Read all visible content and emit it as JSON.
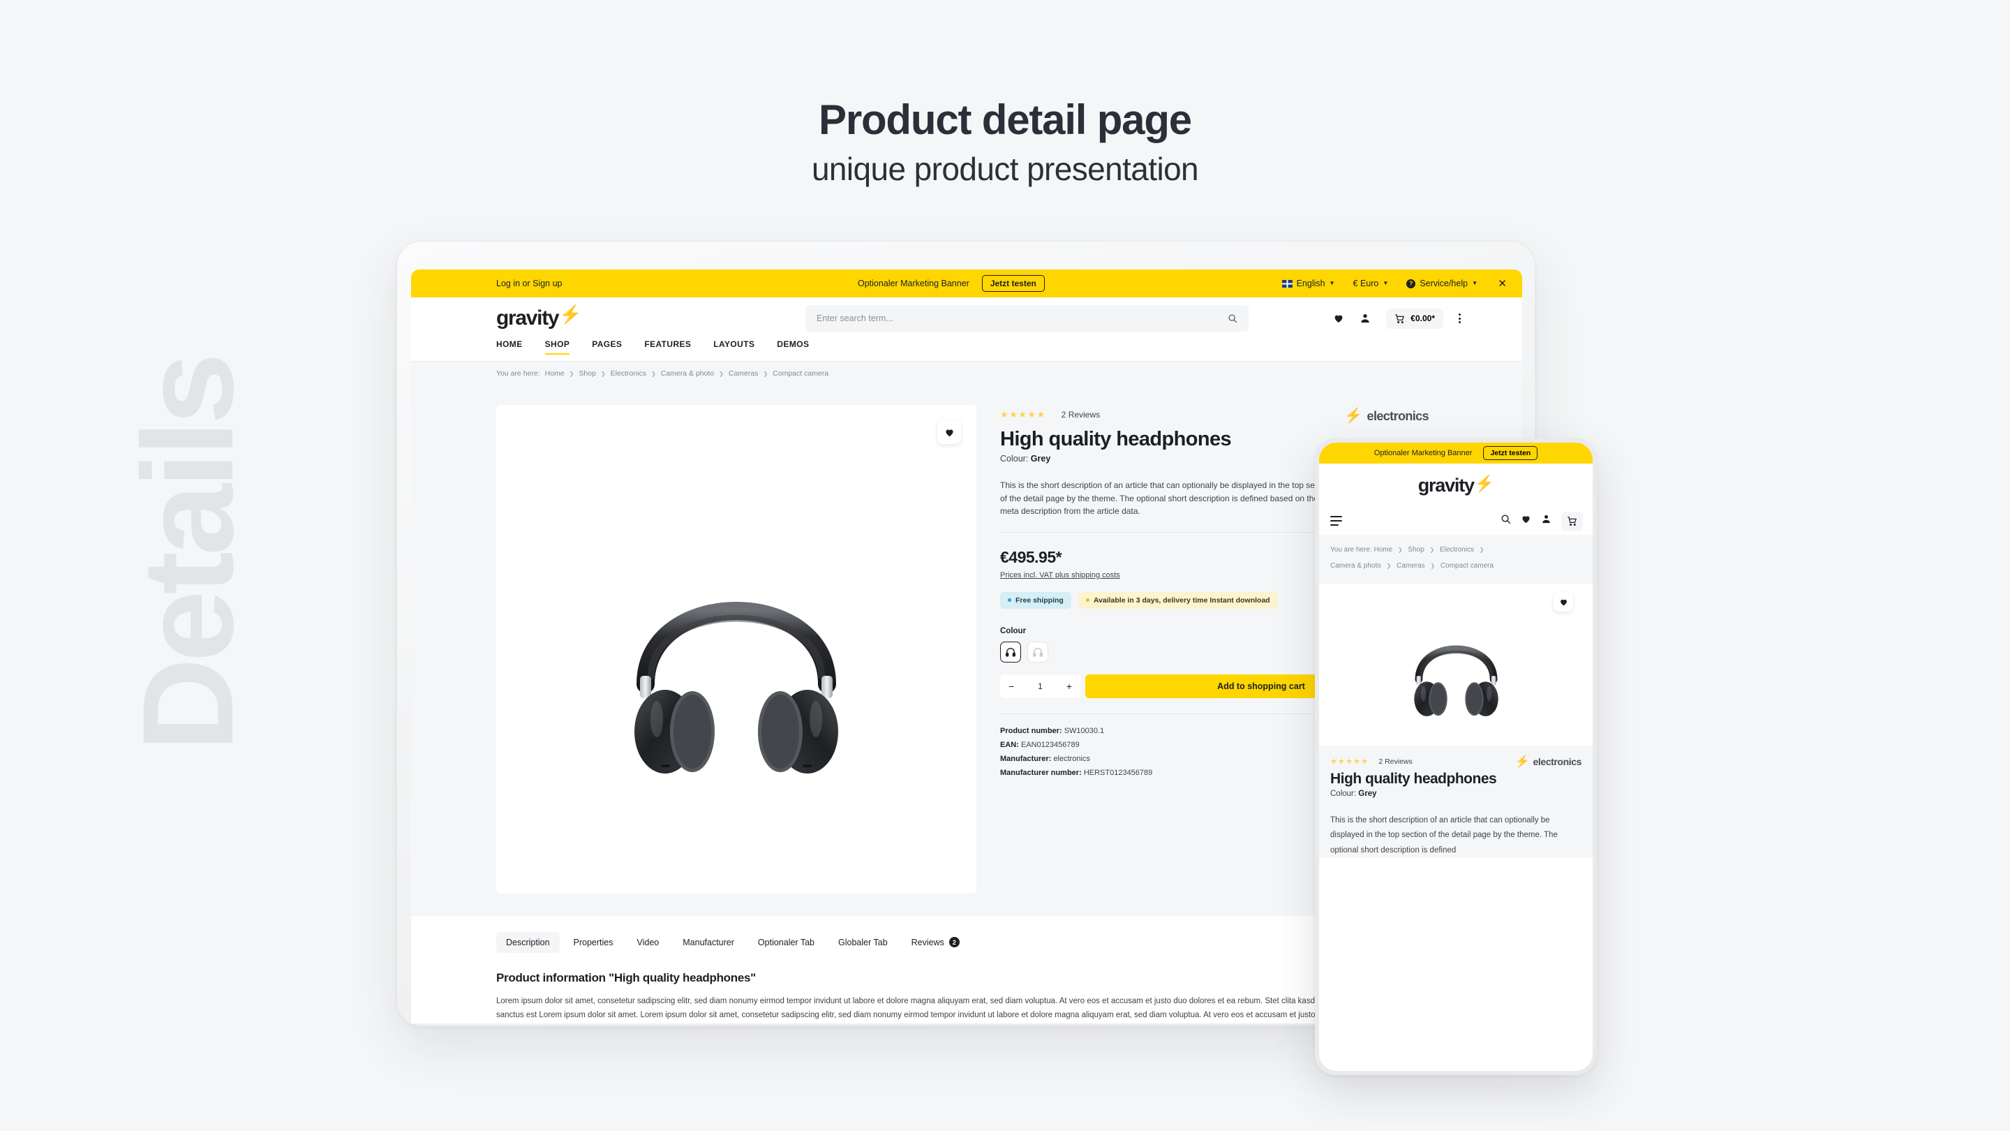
{
  "heading": {
    "title": "Product detail page",
    "subtitle": "unique product presentation"
  },
  "watermark": "Details",
  "colors": {
    "accent": "#ffd600",
    "ink": "#1d1f24",
    "canvas": "#f5f6f7",
    "muted": "#85888e"
  },
  "desktop": {
    "topbar": {
      "login": "Log in or Sign up",
      "banner_text": "Optionaler Marketing Banner",
      "banner_cta": "Jetzt testen",
      "language": "English",
      "currency": "€ Euro",
      "service": "Service/help",
      "close_icon": "✕"
    },
    "header": {
      "logo": "gravity",
      "search_placeholder": "Enter search term...",
      "cart_total": "€0.00*"
    },
    "nav": [
      {
        "label": "HOME",
        "active": false
      },
      {
        "label": "SHOP",
        "active": true
      },
      {
        "label": "PAGES",
        "active": false
      },
      {
        "label": "FEATURES",
        "active": false
      },
      {
        "label": "LAYOUTS",
        "active": false
      },
      {
        "label": "DEMOS",
        "active": false
      }
    ],
    "breadcrumb": {
      "label": "You are here:",
      "items": [
        "Home",
        "Shop",
        "Electronics",
        "Camera & photo",
        "Cameras",
        "Compact camera"
      ]
    },
    "product": {
      "stars": "★★★★★",
      "reviews": "2 Reviews",
      "brand": "electronics",
      "title": "High quality headphones",
      "variant_label": "Colour:",
      "variant_value": "Grey",
      "short_description": "This is the short description of an article that can optionally be displayed in the top section of the detail page by the theme. The optional short description is defined based on the meta description from the article data.",
      "price": "€495.95*",
      "vat_note": "Prices incl. VAT plus shipping costs",
      "badge_shipping": "Free shipping",
      "badge_availability": "Available in 3 days, delivery time Instant download",
      "colour_label": "Colour",
      "qty_minus": "−",
      "qty_value": "1",
      "qty_plus": "+",
      "add_to_cart": "Add to shopping cart",
      "meta": [
        {
          "key": "Product number:",
          "value": "SW10030.1"
        },
        {
          "key": "EAN:",
          "value": "EAN0123456789"
        },
        {
          "key": "Manufacturer:",
          "value": "electronics"
        },
        {
          "key": "Manufacturer number:",
          "value": "HERST0123456789"
        }
      ]
    },
    "tabs": [
      {
        "label": "Description",
        "active": true,
        "count": null
      },
      {
        "label": "Properties",
        "active": false,
        "count": null
      },
      {
        "label": "Video",
        "active": false,
        "count": null
      },
      {
        "label": "Manufacturer",
        "active": false,
        "count": null
      },
      {
        "label": "Optionaler Tab",
        "active": false,
        "count": null
      },
      {
        "label": "Globaler Tab",
        "active": false,
        "count": null
      },
      {
        "label": "Reviews",
        "active": false,
        "count": "2"
      }
    ],
    "tab_content": {
      "heading": "Product information \"High quality headphones\"",
      "body": "Lorem ipsum dolor sit amet, consetetur sadipscing elitr, sed diam nonumy eirmod tempor invidunt ut labore et dolore magna aliquyam erat, sed diam voluptua. At vero eos et accusam et justo duo dolores et ea rebum. Stet clita kasd gubergren, no sea takimata sanctus est Lorem ipsum dolor sit amet. Lorem ipsum dolor sit amet, consetetur sadipscing elitr, sed diam nonumy eirmod tempor invidunt ut labore et dolore magna aliquyam erat, sed diam voluptua. At vero eos et accusam et justo duo dolores et ea rebum. Stet clita kasd gubergren, no sea takimata sanctus est Lorem ipsum dolor sit amet."
    }
  },
  "mobile": {
    "topbar": {
      "banner_text": "Optionaler Marketing Banner",
      "banner_cta": "Jetzt testen"
    },
    "logo": "gravity",
    "breadcrumb": {
      "label": "You are here:",
      "items": [
        "Home",
        "Shop",
        "Electronics",
        "Camera & photo",
        "Cameras",
        "Compact camera"
      ]
    },
    "product": {
      "stars": "★★★★★",
      "reviews": "2 Reviews",
      "brand": "electronics",
      "title": "High quality headphones",
      "variant_label": "Colour:",
      "variant_value": "Grey",
      "short_description": "This is the short description of an article that can optionally be displayed in the top section of the detail page by the theme. The optional short description is defined"
    }
  }
}
